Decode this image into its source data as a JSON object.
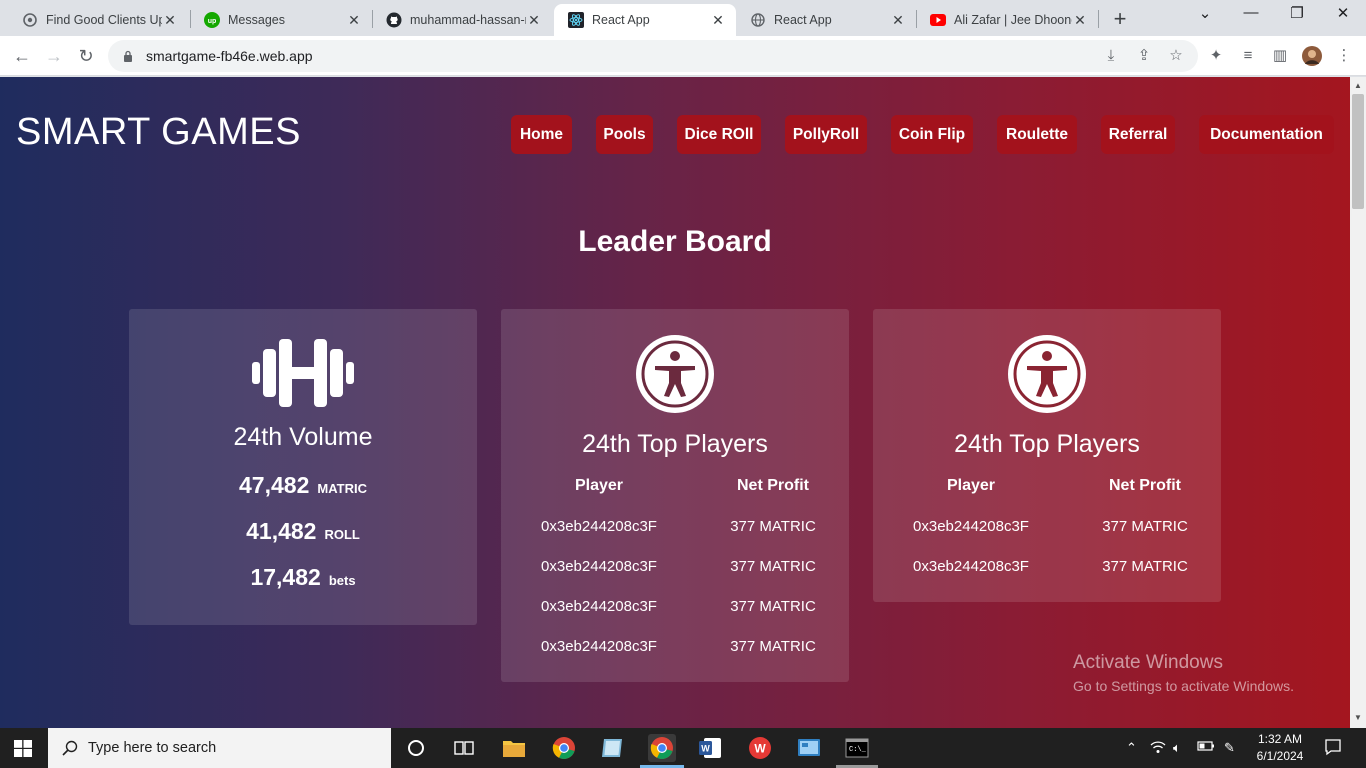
{
  "browser": {
    "tabs": [
      {
        "title": "Find Good Clients Upw",
        "icon": "upwork-tab-icon"
      },
      {
        "title": "Messages",
        "icon": "upwork-logo-icon"
      },
      {
        "title": "muhammad-hassan-n",
        "icon": "github-icon"
      },
      {
        "title": "React App",
        "icon": "react-icon"
      },
      {
        "title": "React App",
        "icon": "globe-icon"
      },
      {
        "title": "Ali Zafar | Jee Dhoond",
        "icon": "youtube-icon"
      }
    ],
    "url": "smartgame-fb46e.web.app"
  },
  "site": {
    "logo": "SMART GAMES",
    "nav": [
      "Home",
      "Pools",
      "Dice ROll",
      "PollyRoll",
      "Coin Flip",
      "Roulette",
      "Referral",
      "Documentation"
    ],
    "heading": "Leader Board",
    "colors": {
      "nav_button": "#a3121c",
      "gradient_start": "#1f2c5e",
      "gradient_end": "#a4161f"
    }
  },
  "cards": {
    "volume": {
      "title": "24th Volume",
      "icon": "dumbbell-icon",
      "stats": [
        {
          "value": "47,482",
          "unit": "MATRIC"
        },
        {
          "value": "41,482",
          "unit": "ROLL"
        },
        {
          "value": "17,482",
          "unit": "bets"
        }
      ]
    },
    "top_players_1": {
      "title": "24th Top Players",
      "icon": "person-circle-icon",
      "headers": [
        "Player",
        "Net Profit"
      ],
      "rows": [
        [
          "0x3eb244208c3F",
          "377 MATRIC"
        ],
        [
          "0x3eb244208c3F",
          "377 MATRIC"
        ],
        [
          "0x3eb244208c3F",
          "377 MATRIC"
        ],
        [
          "0x3eb244208c3F",
          "377 MATRIC"
        ]
      ]
    },
    "top_players_2": {
      "title": "24th Top Players",
      "icon": "person-circle-icon",
      "headers": [
        "Player",
        "Net Profit"
      ],
      "rows": [
        [
          "0x3eb244208c3F",
          "377 MATRIC"
        ],
        [
          "0x3eb244208c3F",
          "377 MATRIC"
        ]
      ]
    }
  },
  "watermark": {
    "line1": "Activate Windows",
    "line2": "Go to Settings to activate Windows."
  },
  "taskbar": {
    "search_placeholder": "Type here to search",
    "time": "1:32 AM",
    "date": "6/1/2024"
  }
}
